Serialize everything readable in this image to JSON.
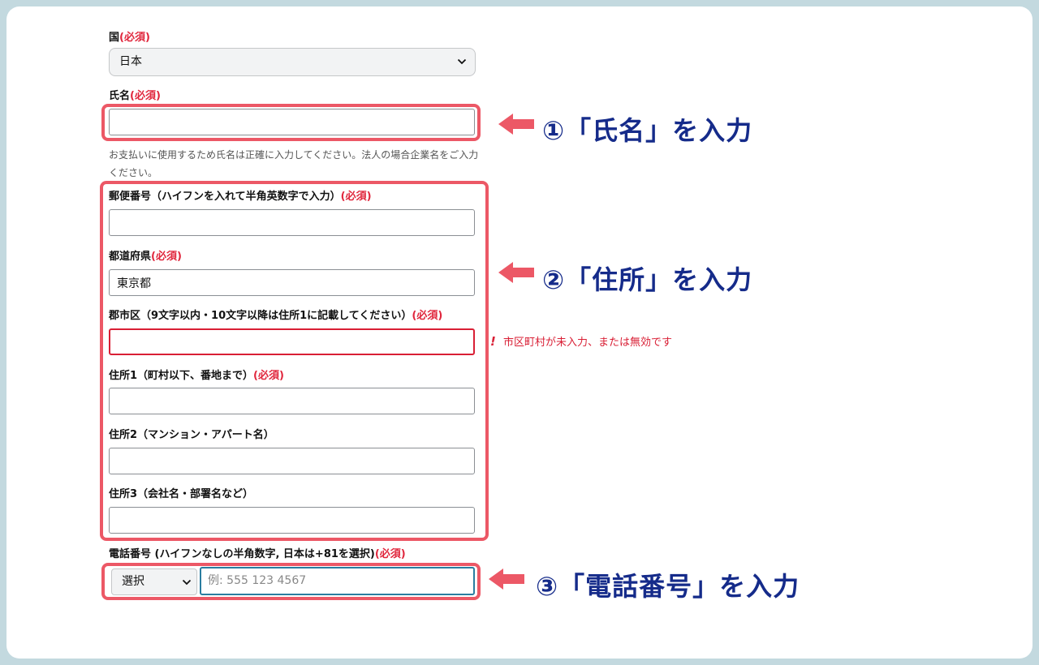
{
  "form": {
    "country": {
      "label": "国",
      "required": "(必須)",
      "value": "日本"
    },
    "name": {
      "label": "氏名",
      "required": "(必須)",
      "value": "",
      "hint": "お支払いに使用するため氏名は正確に入力してください。法人の場合企業名をご入力ください。"
    },
    "postal": {
      "label": "郵便番号（ハイフンを入れて半角英数字で入力）",
      "required": "(必須)",
      "value": ""
    },
    "prefecture": {
      "label": "都道府県",
      "required": "(必須)",
      "value": "東京都"
    },
    "city": {
      "label": "郡市区（9文字以内・10文字以降は住所1に記載してください）",
      "required": "(必須)",
      "value": "",
      "error": "市区町村が未入力、または無効です"
    },
    "address1": {
      "label": "住所1（町村以下、番地まで）",
      "required": "(必須)",
      "value": ""
    },
    "address2": {
      "label": "住所2（マンション・アパート名）",
      "value": ""
    },
    "address3": {
      "label": "住所3（会社名・部署名など）",
      "value": ""
    },
    "phone": {
      "label": "電話番号 (ハイフンなしの半角数字, 日本は+81を選択)",
      "required": "(必須)",
      "country_code": "選択",
      "placeholder": "例: 555 123 4567"
    }
  },
  "annotations": {
    "step1": "①「氏名」を入力",
    "step2": "②「住所」を入力",
    "step3": "③「電話番号」を入力"
  },
  "colors": {
    "highlight": "#ec5866",
    "step_text": "#152b8a",
    "required": "#e0263c",
    "error": "#d91f35"
  },
  "icons": {
    "select_arrow": "chevron-down-icon",
    "annotation_arrow": "arrow-left-icon",
    "error": "exclamation-icon"
  }
}
